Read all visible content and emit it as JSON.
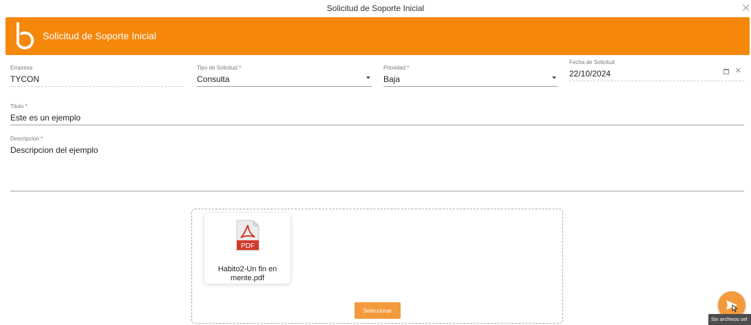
{
  "window": {
    "title": "Solicitud de Soporte Inicial",
    "close_glyph": "✕"
  },
  "header": {
    "title": "Solicitud de Soporte Inicial",
    "background": "#f5870b",
    "logo_icon": "b-logo-icon"
  },
  "form": {
    "empresa": {
      "label": "Empresa",
      "value": "TYCON"
    },
    "tipo_solicitud": {
      "label": "Tipo de Solicitud *",
      "value": "Consulta"
    },
    "prioridad": {
      "label": "Prioridad *",
      "value": "Baja"
    },
    "fecha_solicitud": {
      "label": "Fecha de Solicitud",
      "value": "22/10/2024"
    },
    "titulo": {
      "label": "Titulo *",
      "value": "Este es un ejemplo"
    },
    "descripcion": {
      "label": "Descripción *",
      "value": "Descripcion del ejemplo"
    }
  },
  "attachments": {
    "files": [
      {
        "name": "Habito2-Un fin en mente.pdf",
        "icon": "pdf-file-icon"
      }
    ],
    "select_label": "Seleccionar"
  },
  "send": {
    "icon": "send-icon",
    "tooltip": "Sin archivos sel",
    "color": "#f39a3c"
  }
}
